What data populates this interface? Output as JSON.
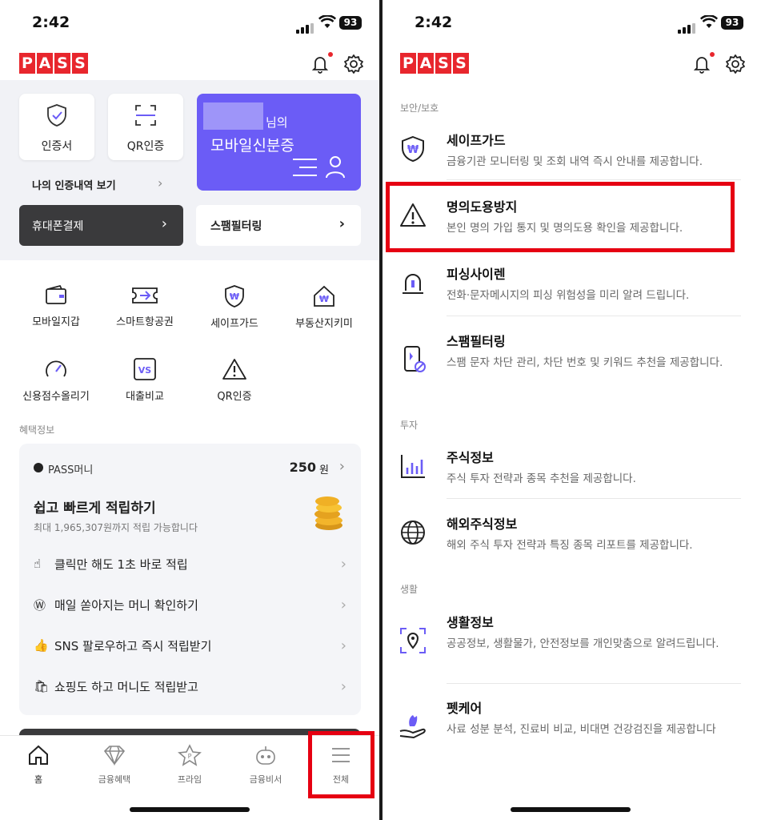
{
  "status": {
    "time": "2:42",
    "battery": "93"
  },
  "logo": [
    "P",
    "A",
    "S",
    "S"
  ],
  "left": {
    "cards": {
      "cert": "인증서",
      "qr": "QR인증",
      "history_link": "나의 인증내역 보기",
      "id_suffix": "님의",
      "id_title": "모바일신분증",
      "phone_pay": "휴대폰결제",
      "spam": "스팸필터링"
    },
    "grid": [
      {
        "label": "모바일지갑",
        "icon": "wallet-icon"
      },
      {
        "label": "스마트항공권",
        "icon": "ticket-icon"
      },
      {
        "label": "세이프가드",
        "icon": "shield-icon"
      },
      {
        "label": "부동산지키미",
        "icon": "house-icon"
      },
      {
        "label": "신용점수올리기",
        "icon": "gauge-icon"
      },
      {
        "label": "대출비교",
        "icon": "vs-icon"
      },
      {
        "label": "QR인증",
        "icon": "warning-icon"
      }
    ],
    "benefit_section": "혜택정보",
    "benefit": {
      "money_label": "PASS머니",
      "money_value": "250",
      "money_unit": "원",
      "headline": "쉽고 빠르게 적립하기",
      "sub": "최대 1,965,307원까지 적립 가능합니다",
      "rows": [
        "클릭만 해도 1초 바로 적립",
        "매일 쏟아지는 머니 확인하기",
        "SNS 팔로우하고 즉시 적립받기",
        "쇼핑도 하고 머니도 적립받고"
      ]
    },
    "tabs": [
      "홈",
      "금융혜택",
      "프라임",
      "금융비서",
      "전체"
    ]
  },
  "right": {
    "sections": {
      "security": "보안/보호",
      "invest": "투자",
      "life": "생활"
    },
    "items": [
      {
        "title": "세이프가드",
        "desc": "금융기관 모니터링 및 조회 내역 즉시 안내를 제공합니다."
      },
      {
        "title": "명의도용방지",
        "desc": "본인 명의 가입 통지 및 명의도용 확인을 제공합니다."
      },
      {
        "title": "피싱사이렌",
        "desc": "전화·문자메시지의 피싱 위험성을 미리 알려 드립니다."
      },
      {
        "title": "스팸필터링",
        "desc": "스팸 문자 차단 관리, 차단 번호 및 키워드 추천을 제공합니다."
      },
      {
        "title": "주식정보",
        "desc": "주식 투자 전략과 종목 추천을 제공합니다."
      },
      {
        "title": "해외주식정보",
        "desc": "해외 주식 투자 전략과 특징 종목 리포트를 제공합니다."
      },
      {
        "title": "생활정보",
        "desc": "공공정보, 생활물가, 안전정보를 개인맞춤으로 알려드립니다."
      },
      {
        "title": "펫케어",
        "desc": "사료 성분 분석, 진료비 비교, 비대면 건강검진을 제공합니다"
      }
    ]
  },
  "colors": {
    "brand_red": "#e8262d",
    "purple": "#6b5cf6",
    "highlight": "#e60012"
  }
}
